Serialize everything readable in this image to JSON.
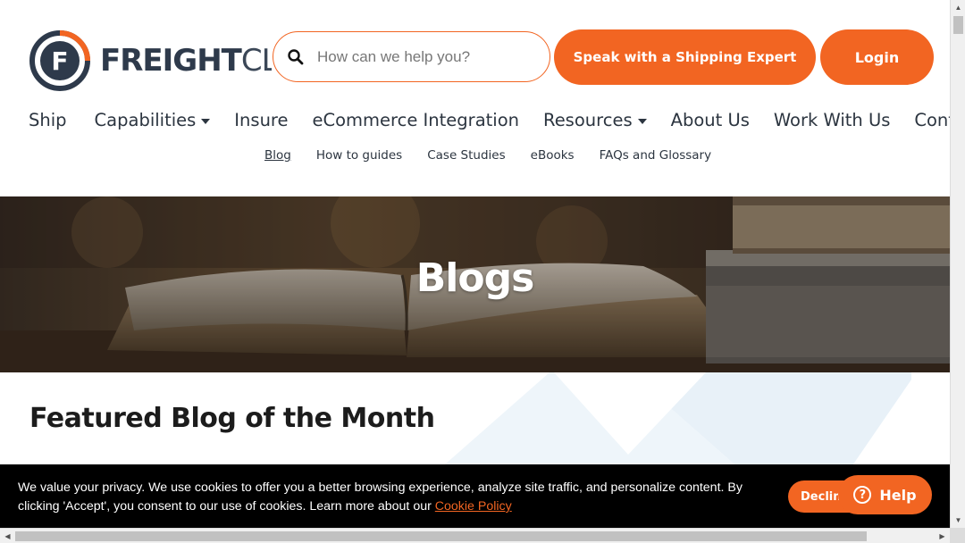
{
  "header": {
    "logo_text_bold": "FREIGHT",
    "logo_text_thin": "CL",
    "logo_letter": "F",
    "search_placeholder": "How can we help you?",
    "expert_button": "Speak with a Shipping Expert",
    "login_button": "Login"
  },
  "main_nav": [
    {
      "label": "Ship"
    },
    {
      "label": "Capabilities"
    },
    {
      "label": "Insure"
    },
    {
      "label": "eCommerce Integration"
    },
    {
      "label": "Resources"
    },
    {
      "label": "About Us"
    },
    {
      "label": "Work With Us"
    },
    {
      "label": "Contact"
    }
  ],
  "sub_nav": [
    {
      "label": "Blog",
      "active": true
    },
    {
      "label": "How to guides"
    },
    {
      "label": "Case Studies"
    },
    {
      "label": "eBooks"
    },
    {
      "label": "FAQs and Glossary"
    }
  ],
  "hero": {
    "title": "Blogs"
  },
  "featured": {
    "title": "Featured Blog of the Month"
  },
  "cookie": {
    "text": "We value your privacy. We use cookies to offer you a better browsing experience, analyze site traffic, and personalize content. By clicking 'Accept', you consent to our use of cookies. Learn more about our",
    "link": "Cookie Policy",
    "decline_button": "Decline",
    "help_button": "Help",
    "help_icon_glyph": "?"
  },
  "colors": {
    "accent": "#f26522",
    "navy": "#2e3a4b",
    "text": "#2c3540"
  }
}
